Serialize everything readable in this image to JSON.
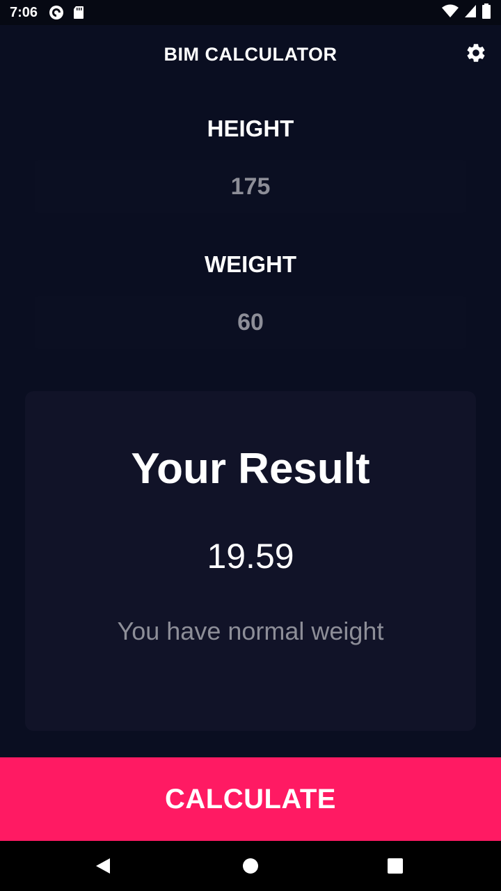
{
  "status_bar": {
    "time": "7:06",
    "icons": [
      "pocket-casts-icon",
      "sd-card-icon",
      "wifi-icon",
      "signal-icon",
      "battery-icon"
    ]
  },
  "app_bar": {
    "title": "BIM CALCULATOR",
    "settings_icon": "gear-icon"
  },
  "height": {
    "label": "HEIGHT",
    "value": "175"
  },
  "weight": {
    "label": "WEIGHT",
    "value": "60"
  },
  "result": {
    "title": "Your Result",
    "value": "19.59",
    "message": "You have normal weight"
  },
  "calculate_button": {
    "label": "CALCULATE"
  },
  "nav_bar": {
    "icons": [
      "back-icon",
      "home-icon",
      "recents-icon"
    ]
  },
  "colors": {
    "background": "#0a0e21",
    "card": "#111328",
    "accent": "#ff1a63",
    "muted_text": "#8d8e98"
  }
}
